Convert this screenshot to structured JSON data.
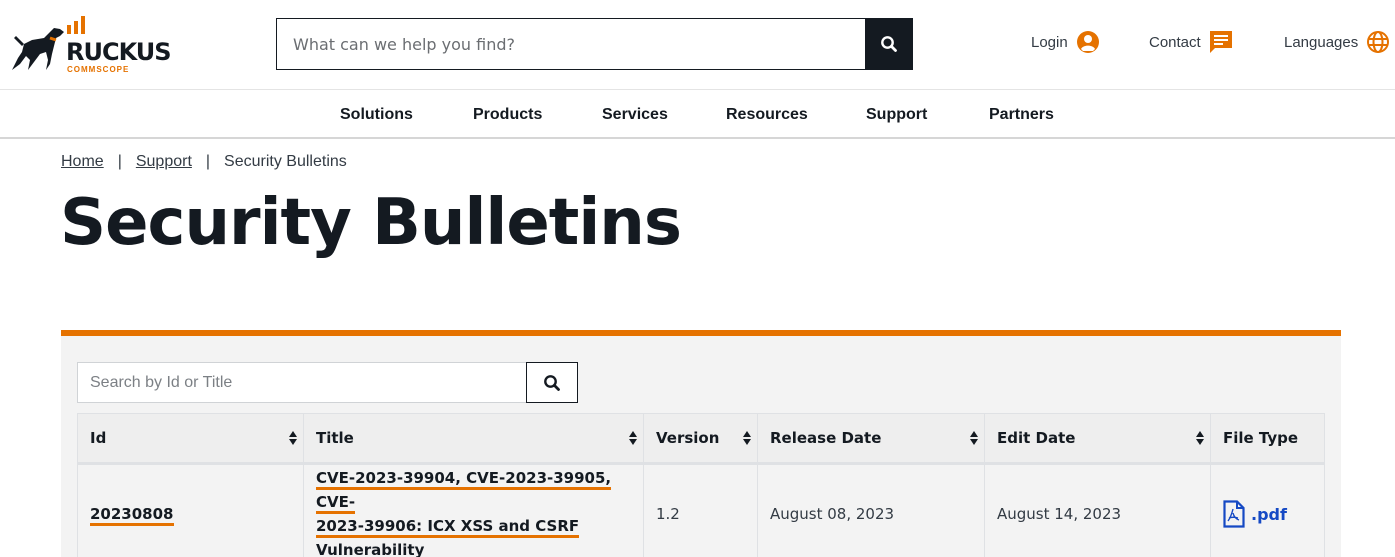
{
  "header": {
    "logo": {
      "brand": "RUCKUS",
      "sub": "COMMSCOPE",
      "icon": "ruckus-dog-logo"
    },
    "search": {
      "placeholder": "What can we help you find?",
      "value": "",
      "icon": "search-icon"
    },
    "utilities": [
      {
        "label": "Login",
        "icon": "user-circle-icon"
      },
      {
        "label": "Contact",
        "icon": "chat-icon"
      },
      {
        "label": "Languages",
        "icon": "globe-icon"
      }
    ]
  },
  "nav": {
    "items": [
      "Solutions",
      "Products",
      "Services",
      "Resources",
      "Support",
      "Partners"
    ]
  },
  "breadcrumb": {
    "items": [
      {
        "label": "Home",
        "link": true
      },
      {
        "label": "Support",
        "link": true
      },
      {
        "label": "Security Bulletins",
        "link": false
      }
    ],
    "separator": "|"
  },
  "page": {
    "title": "Security Bulletins"
  },
  "table_search": {
    "placeholder": "Search by Id or Title",
    "value": "",
    "icon": "search-icon"
  },
  "table": {
    "columns": [
      {
        "label": "Id",
        "sortable": true
      },
      {
        "label": "Title",
        "sortable": true
      },
      {
        "label": "Version",
        "sortable": true
      },
      {
        "label": "Release Date",
        "sortable": true
      },
      {
        "label": "Edit Date",
        "sortable": true
      },
      {
        "label": "File Type",
        "sortable": false
      }
    ],
    "rows": [
      {
        "id": "20230808",
        "title": "CVE-2023-39904, CVE-2023-39905, CVE-2023-39906: ICX XSS and CSRF Vulnerability",
        "title_lines": [
          "CVE-2023-39904, CVE-2023-39905, CVE-",
          "2023-39906: ICX XSS and CSRF",
          "Vulnerability"
        ],
        "version": "1.2",
        "release_date": "August 08, 2023",
        "edit_date": "August 14, 2023",
        "file_type": ".pdf",
        "file_icon": "pdf-file-icon"
      }
    ]
  },
  "colors": {
    "accent": "#e57200",
    "dark": "#141a21",
    "link_blue": "#1549c4",
    "panel_bg": "#f3f3f3"
  }
}
